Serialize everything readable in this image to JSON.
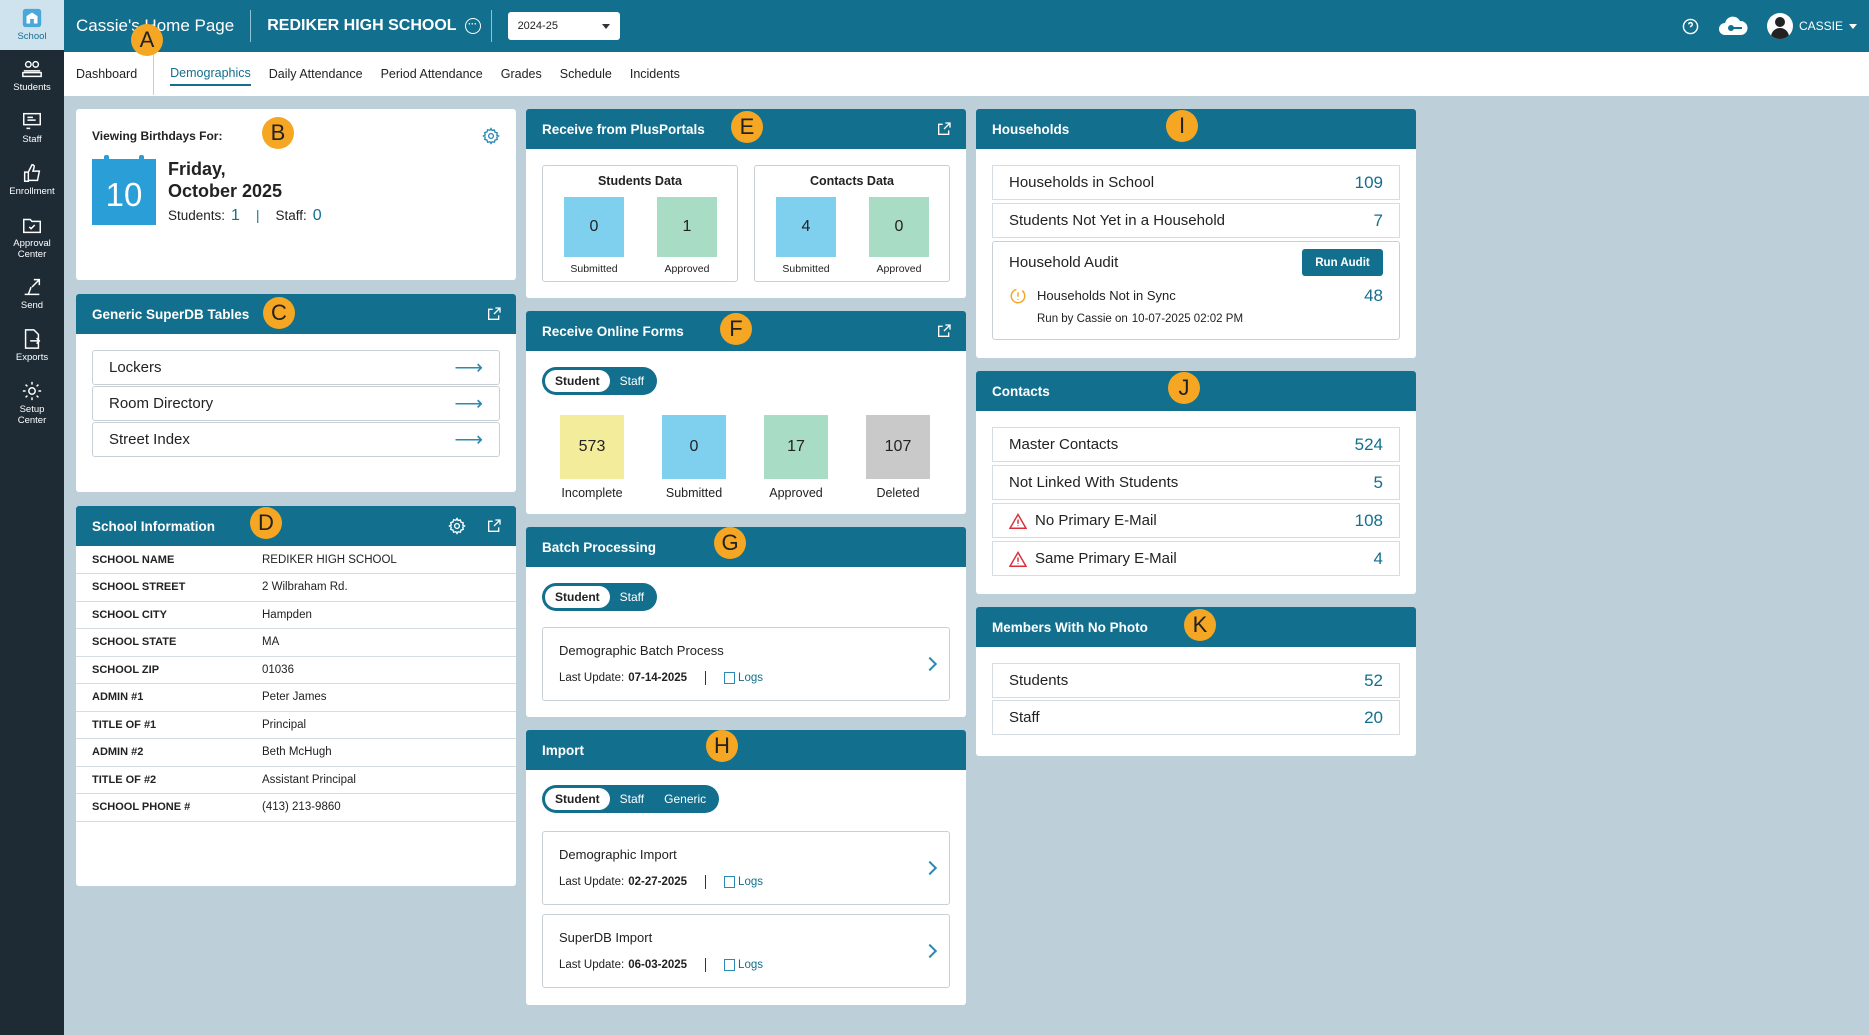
{
  "sidebar": {
    "items": [
      {
        "label": "School",
        "icon": "school-icon"
      },
      {
        "label": "Students",
        "icon": "students-icon"
      },
      {
        "label": "Staff",
        "icon": "staff-icon"
      },
      {
        "label": "Enrollment",
        "icon": "enrollment-icon"
      },
      {
        "label": "Approval Center",
        "icon": "approval-center-icon"
      },
      {
        "label": "Send",
        "icon": "send-icon"
      },
      {
        "label": "Exports",
        "icon": "exports-icon"
      },
      {
        "label": "Setup Center",
        "icon": "setup-center-icon"
      }
    ]
  },
  "topbar": {
    "home_title": "Cassie's Home Page",
    "school_name": "REDIKER HIGH SCHOOL",
    "year": "2024-25",
    "user": "CASSIE"
  },
  "tabs": [
    "Dashboard",
    "Demographics",
    "Daily Attendance",
    "Period Attendance",
    "Grades",
    "Schedule",
    "Incidents"
  ],
  "markers": [
    "A",
    "B",
    "C",
    "D",
    "E",
    "F",
    "G",
    "H",
    "I",
    "J",
    "K"
  ],
  "birthdays": {
    "title": "Viewing Birthdays For:",
    "day": "10",
    "weekday": "Friday,",
    "month_year": "October 2025",
    "students_label": "Students:",
    "students_count": "1",
    "sep": "|",
    "staff_label": "Staff:",
    "staff_count": "0"
  },
  "superdb": {
    "title": "Generic SuperDB Tables",
    "items": [
      "Lockers",
      "Room Directory",
      "Street Index"
    ]
  },
  "school_info": {
    "title": "School Information",
    "rows": [
      {
        "k": "SCHOOL NAME",
        "v": "REDIKER HIGH SCHOOL"
      },
      {
        "k": "SCHOOL STREET",
        "v": "2 Wilbraham Rd."
      },
      {
        "k": "SCHOOL CITY",
        "v": "Hampden"
      },
      {
        "k": "SCHOOL STATE",
        "v": "MA"
      },
      {
        "k": "SCHOOL ZIP",
        "v": "01036"
      },
      {
        "k": "ADMIN #1",
        "v": "Peter James"
      },
      {
        "k": "TITLE OF #1",
        "v": "Principal"
      },
      {
        "k": "ADMIN #2",
        "v": "Beth McHugh"
      },
      {
        "k": "TITLE OF #2",
        "v": "Assistant Principal"
      },
      {
        "k": "SCHOOL PHONE #",
        "v": "(413) 213-9860"
      }
    ]
  },
  "plusportals": {
    "title": "Receive from PlusPortals",
    "students": {
      "title": "Students Data",
      "submitted": "0",
      "approved": "1"
    },
    "contacts": {
      "title": "Contacts Data",
      "submitted": "4",
      "approved": "0"
    },
    "submitted_label": "Submitted",
    "approved_label": "Approved"
  },
  "online_forms": {
    "title": "Receive Online Forms",
    "toggle": [
      "Student",
      "Staff"
    ],
    "stats": [
      {
        "value": "573",
        "label": "Incomplete",
        "color": "#f3ec9a"
      },
      {
        "value": "0",
        "label": "Submitted",
        "color": "#7fd0ee"
      },
      {
        "value": "17",
        "label": "Approved",
        "color": "#a9dcc4"
      },
      {
        "value": "107",
        "label": "Deleted",
        "color": "#c9c9c9"
      }
    ]
  },
  "batch": {
    "title": "Batch Processing",
    "toggle": [
      "Student",
      "Staff"
    ],
    "item": {
      "name": "Demographic Batch Process",
      "update_label": "Last Update:",
      "date": "07-14-2025",
      "logs": "Logs"
    }
  },
  "import": {
    "title": "Import",
    "toggle": [
      "Student",
      "Staff",
      "Generic"
    ],
    "items": [
      {
        "name": "Demographic Import",
        "update_label": "Last Update:",
        "date": "02-27-2025",
        "logs": "Logs"
      },
      {
        "name": "SuperDB Import",
        "update_label": "Last Update:",
        "date": "06-03-2025",
        "logs": "Logs"
      }
    ]
  },
  "households": {
    "title": "Households",
    "rows": [
      {
        "label": "Households in School",
        "value": "109"
      },
      {
        "label": "Students Not Yet in a Household",
        "value": "7"
      }
    ],
    "audit": {
      "label": "Household Audit",
      "button": "Run Audit",
      "sync_label": "Households Not in Sync",
      "sync_value": "48",
      "run_by": "Run by Cassie on",
      "run_date": "10-07-2025 02:02 PM"
    }
  },
  "contacts": {
    "title": "Contacts",
    "rows": [
      {
        "label": "Master Contacts",
        "value": "524",
        "warn": false
      },
      {
        "label": "Not Linked With Students",
        "value": "5",
        "warn": false
      },
      {
        "label": "No Primary E-Mail",
        "value": "108",
        "warn": true
      },
      {
        "label": "Same Primary E-Mail",
        "value": "4",
        "warn": true
      }
    ]
  },
  "nophoto": {
    "title": "Members With No Photo",
    "rows": [
      {
        "label": "Students",
        "value": "52"
      },
      {
        "label": "Staff",
        "value": "20"
      }
    ]
  },
  "colors": {
    "brand": "#136f8e",
    "sidebar": "#1e2b35",
    "background": "#bdd0d9",
    "marker": "#f5a623"
  }
}
